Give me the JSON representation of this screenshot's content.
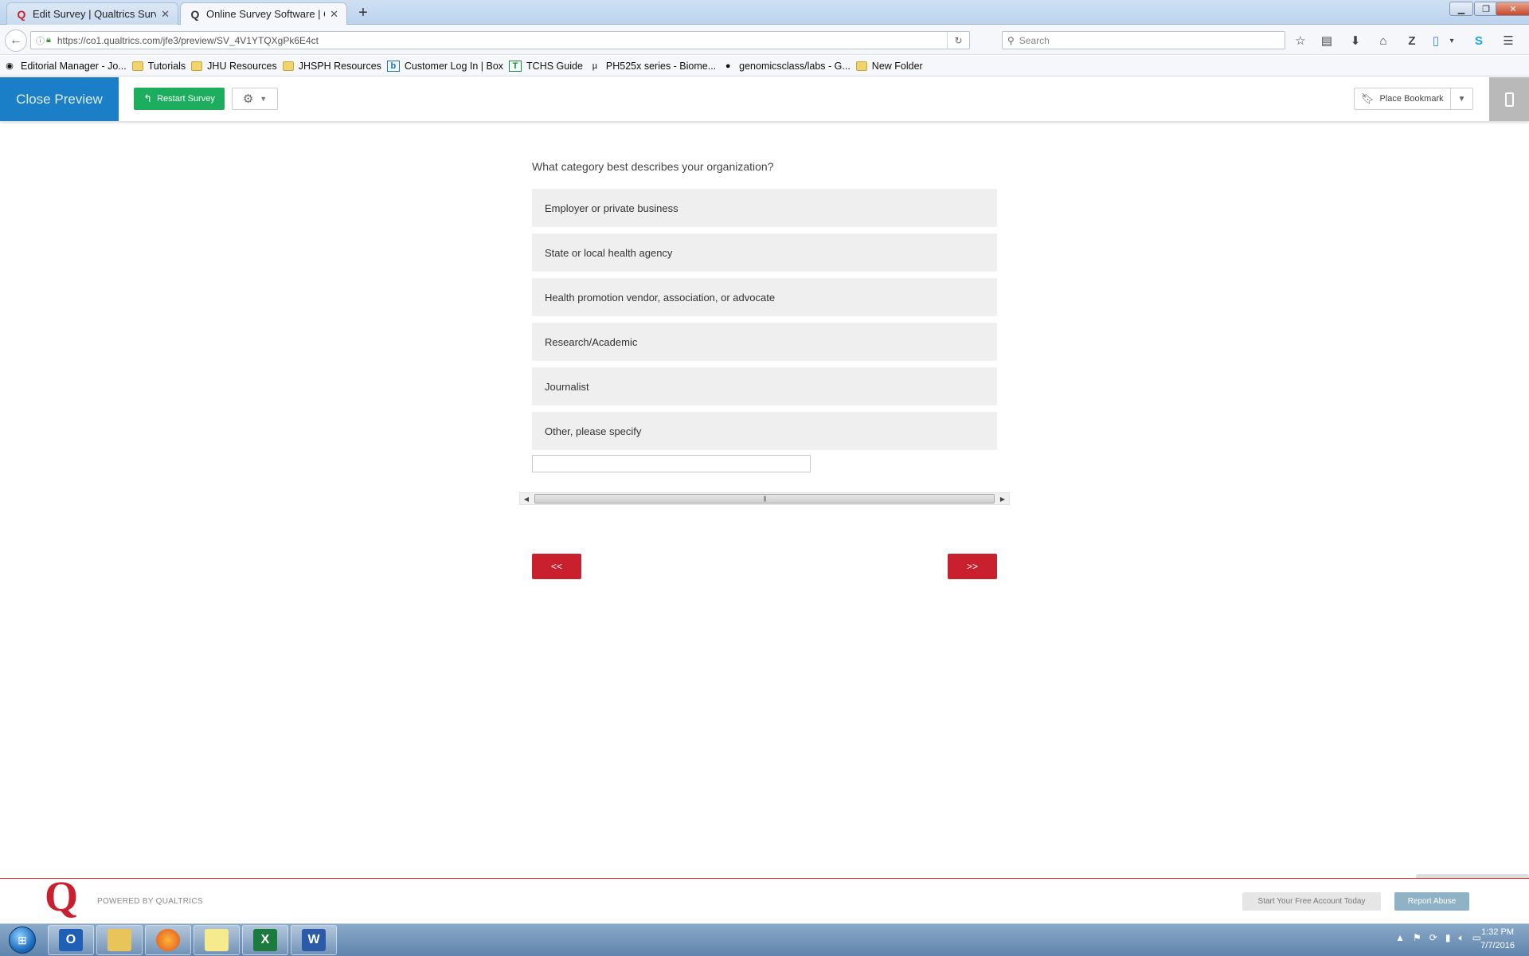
{
  "browser": {
    "tabs": [
      {
        "title": "Edit Survey | Qualtrics Surv...",
        "favicon": "qualtrics-icon"
      },
      {
        "title": "Online Survey Software | Q...",
        "favicon": "qualtrics-icon"
      }
    ],
    "url": "https://co1.qualtrics.com/jfe3/preview/SV_4V1YTQXgPk6E4ct",
    "search_placeholder": "Search",
    "bookmarks": [
      "Editorial Manager - Jo...",
      "Tutorials",
      "JHU Resources",
      "JHSPH Resources",
      "Customer Log In | Box",
      "TCHS Guide",
      "PH525x series - Biome...",
      "genomicsclass/labs - G...",
      "New Folder"
    ]
  },
  "preview_bar": {
    "close_label": "Close Preview",
    "restart_label": "Restart Survey",
    "bookmark_label": "Place Bookmark"
  },
  "survey": {
    "question": "What category best describes your organization?",
    "choices": [
      "Employer or private business",
      "State or local health agency",
      "Health promotion vendor, association, or advocate",
      "Research/Academic",
      "Journalist",
      "Other, please specify"
    ],
    "other_value": "",
    "back_label": "<<",
    "next_label": ">>"
  },
  "footer": {
    "powered_by": "POWERED BY QUALTRICS",
    "free_account": "Start Your Free Account Today",
    "report_abuse": "Report Abuse"
  },
  "taskbar": {
    "time": "1:32 PM",
    "date": "7/7/2016"
  },
  "colors": {
    "accent_blue": "#1a7fc7",
    "restart_green": "#1cae5e",
    "nav_red": "#c8202f"
  }
}
